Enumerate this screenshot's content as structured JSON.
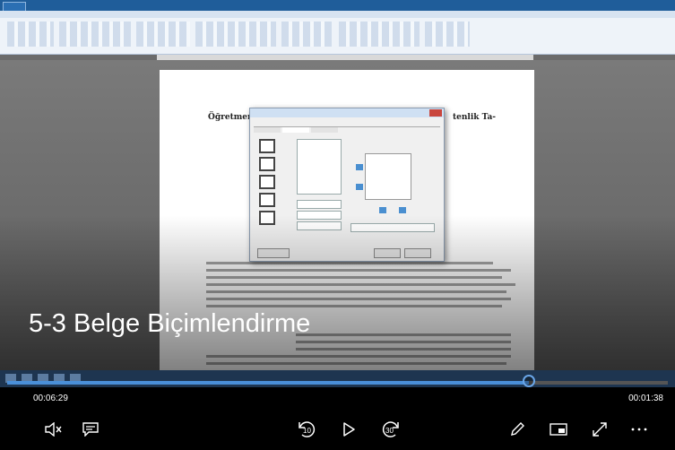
{
  "video": {
    "document_heading_left": "Öğretmen",
    "document_heading_right": "tenlik Ta-",
    "title": "5-3 Belge Biçimlendirme"
  },
  "player": {
    "current_time": "00:06:29",
    "remaining_time": "00:01:38",
    "progress": 0.79,
    "rewind_seconds": "10",
    "forward_seconds": "30"
  },
  "icons": {
    "mute": "volume-muted-icon",
    "captions": "captions-icon",
    "rewind": "rewind-10-icon",
    "play": "play-icon",
    "forward": "forward-30-icon",
    "pen": "pen-icon",
    "miniview": "mini-view-icon",
    "fullscreen": "fullscreen-icon",
    "more": "more-icon"
  },
  "colors": {
    "accent": "#4a8fd8",
    "background": "#000000"
  }
}
